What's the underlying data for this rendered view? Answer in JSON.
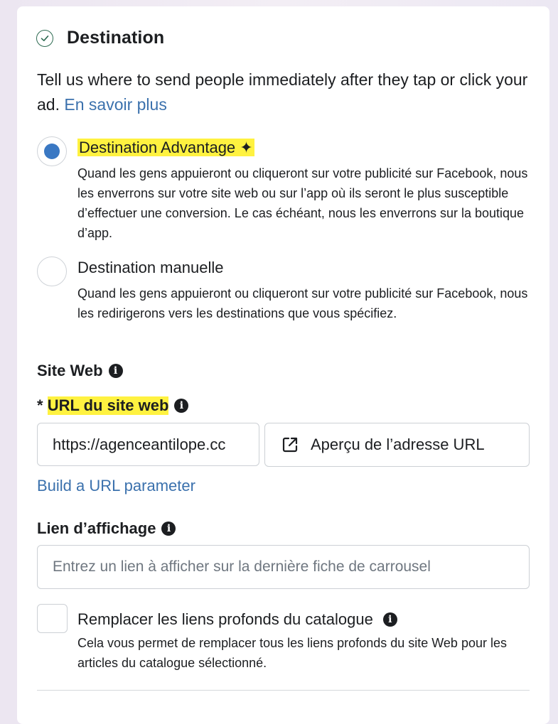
{
  "section": {
    "title": "Destination",
    "description": "Tell us where to send people immediately after they tap or click your ad.",
    "learn_more": "En savoir plus"
  },
  "options": [
    {
      "title": "Destination Advantage",
      "sparkle": "✦",
      "description": "Quand les gens appuieront ou cliqueront sur votre publicité sur Facebook, nous les enverrons sur votre site web ou sur l’app où ils seront le plus susceptible d’effectuer une conversion. Le cas échéant, nous les enverrons sur la boutique d’app.",
      "selected": true
    },
    {
      "title": "Destination manuelle",
      "description": "Quand les gens appuieront ou cliqueront sur votre publicité sur Facebook, nous les redirigerons vers les destinations que vous spécifiez.",
      "selected": false
    }
  ],
  "website": {
    "heading": "Site Web",
    "url_required_mark": "* ",
    "url_label": "URL du site web",
    "url_value": "https://agenceantilope.cc",
    "preview_button": "Aperçu de l’adresse URL",
    "build_param_link": "Build a URL parameter"
  },
  "display_link": {
    "label": "Lien d’affichage",
    "placeholder": "Entrez un lien à afficher sur la dernière fiche de carrousel"
  },
  "deep_links": {
    "label": "Remplacer les liens profonds du catalogue",
    "description": "Cela vous permet de remplacer tous les liens profonds du site Web pour les articles du catalogue sélectionné.",
    "checked": false
  },
  "icons": {
    "section_status": "check-circle-icon",
    "info": "info-icon",
    "preview": "external-link-icon"
  },
  "colors": {
    "accent": "#3a78c3",
    "link": "#3b71ad",
    "highlight": "#fff240",
    "success": "#2e6b52"
  }
}
